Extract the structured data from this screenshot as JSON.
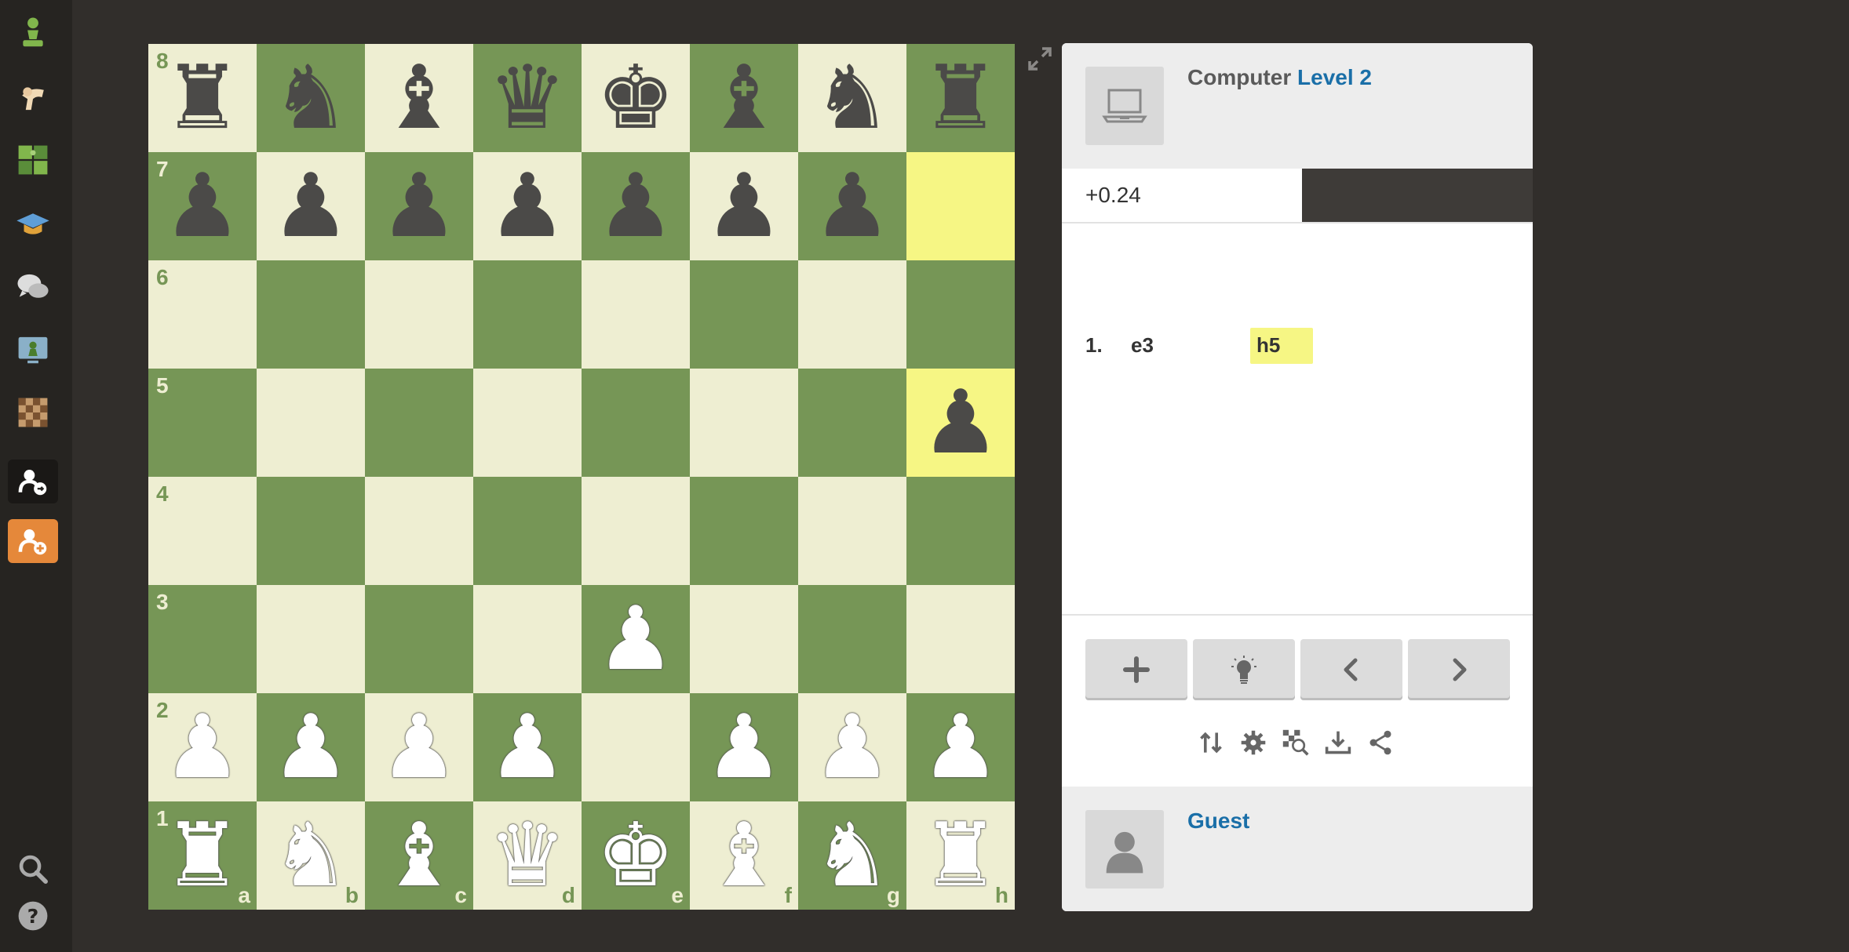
{
  "colors": {
    "light_square": "#eeeed2",
    "dark_square": "#769656",
    "highlight": "#f6f684",
    "link_blue": "#1a6fa8",
    "orange": "#e5883a"
  },
  "sidebar": {
    "items": [
      {
        "icon": "pawn-logo-icon"
      },
      {
        "icon": "play-hand-icon"
      },
      {
        "icon": "puzzle-icon"
      },
      {
        "icon": "learn-cap-icon"
      },
      {
        "icon": "chat-icon"
      },
      {
        "icon": "watch-screen-icon"
      },
      {
        "icon": "board-icon"
      },
      {
        "icon": "login-icon"
      },
      {
        "icon": "signup-icon"
      },
      {
        "icon": "search-icon"
      },
      {
        "icon": "help-icon"
      }
    ]
  },
  "board": {
    "ranks": [
      "8",
      "7",
      "6",
      "5",
      "4",
      "3",
      "2",
      "1"
    ],
    "files": [
      "a",
      "b",
      "c",
      "d",
      "e",
      "f",
      "g",
      "h"
    ],
    "highlighted": [
      "h7",
      "h5"
    ],
    "rows": [
      [
        "bR",
        "bN",
        "bB",
        "bQ",
        "bK",
        "bB",
        "bN",
        "bR"
      ],
      [
        "bP",
        "bP",
        "bP",
        "bP",
        "bP",
        "bP",
        "bP",
        ""
      ],
      [
        "",
        "",
        "",
        "",
        "",
        "",
        "",
        ""
      ],
      [
        "",
        "",
        "",
        "",
        "",
        "",
        "",
        "bP"
      ],
      [
        "",
        "",
        "",
        "",
        "",
        "",
        "",
        ""
      ],
      [
        "",
        "",
        "",
        "",
        "wP",
        "",
        "",
        ""
      ],
      [
        "wP",
        "wP",
        "wP",
        "wP",
        "",
        "wP",
        "wP",
        "wP"
      ],
      [
        "wR",
        "wN",
        "wB",
        "wQ",
        "wK",
        "wB",
        "wN",
        "wR"
      ]
    ]
  },
  "opponent": {
    "name": "Computer",
    "level": "Level 2"
  },
  "evaluation": "+0.24",
  "moves": [
    {
      "num": "1.",
      "white": "e3",
      "black": "h5"
    }
  ],
  "controls": [
    {
      "icon": "plus-icon"
    },
    {
      "icon": "hint-bulb-icon"
    },
    {
      "icon": "chevron-left-icon"
    },
    {
      "icon": "chevron-right-icon"
    }
  ],
  "tools": [
    {
      "icon": "flip-board-icon"
    },
    {
      "icon": "gear-icon"
    },
    {
      "icon": "analysis-icon"
    },
    {
      "icon": "download-icon"
    },
    {
      "icon": "share-icon"
    }
  ],
  "player": {
    "name": "Guest"
  }
}
